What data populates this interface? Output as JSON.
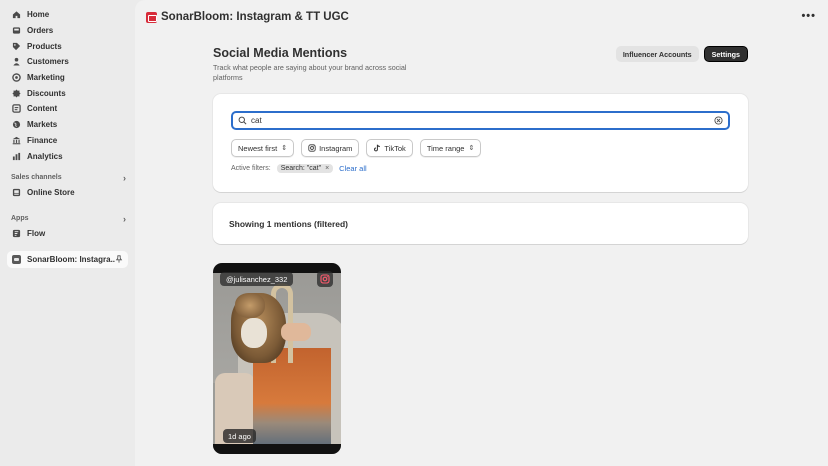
{
  "sidebar": {
    "items": [
      {
        "label": "Home",
        "icon": "home-icon"
      },
      {
        "label": "Orders",
        "icon": "orders-icon"
      },
      {
        "label": "Products",
        "icon": "tag-icon"
      },
      {
        "label": "Customers",
        "icon": "person-icon"
      },
      {
        "label": "Marketing",
        "icon": "target-icon"
      },
      {
        "label": "Discounts",
        "icon": "discount-icon"
      },
      {
        "label": "Content",
        "icon": "content-icon"
      },
      {
        "label": "Markets",
        "icon": "globe-icon"
      },
      {
        "label": "Finance",
        "icon": "bank-icon"
      },
      {
        "label": "Analytics",
        "icon": "chart-icon"
      }
    ],
    "sales_channels_label": "Sales channels",
    "online_store_label": "Online Store",
    "apps_label": "Apps",
    "flow_label": "Flow",
    "pinned_app_label": "SonarBloom: Instagra..."
  },
  "header": {
    "app_title": "SonarBloom: Instagram & TT UGC",
    "more_label": "•••"
  },
  "page": {
    "title": "Social Media Mentions",
    "subtitle": "Track what people are saying about your brand across social platforms",
    "influencer_button": "Influencer Accounts",
    "settings_button": "Settings"
  },
  "filters": {
    "search_value": "cat",
    "sort_label": "Newest first",
    "instagram_label": "Instagram",
    "tiktok_label": "TikTok",
    "time_range_label": "Time range",
    "active_filters_label": "Active filters:",
    "chip_label": "Search: \"cat\"",
    "clear_all_label": "Clear all"
  },
  "results": {
    "count_label": "Showing 1 mentions (filtered)"
  },
  "post": {
    "handle": "@julisanchez_332",
    "age": "1d ago",
    "platform_icon": "instagram-icon"
  },
  "colors": {
    "accent": "#2c6ecb",
    "brand": "#d72c3a",
    "primary_button": "#303030"
  }
}
